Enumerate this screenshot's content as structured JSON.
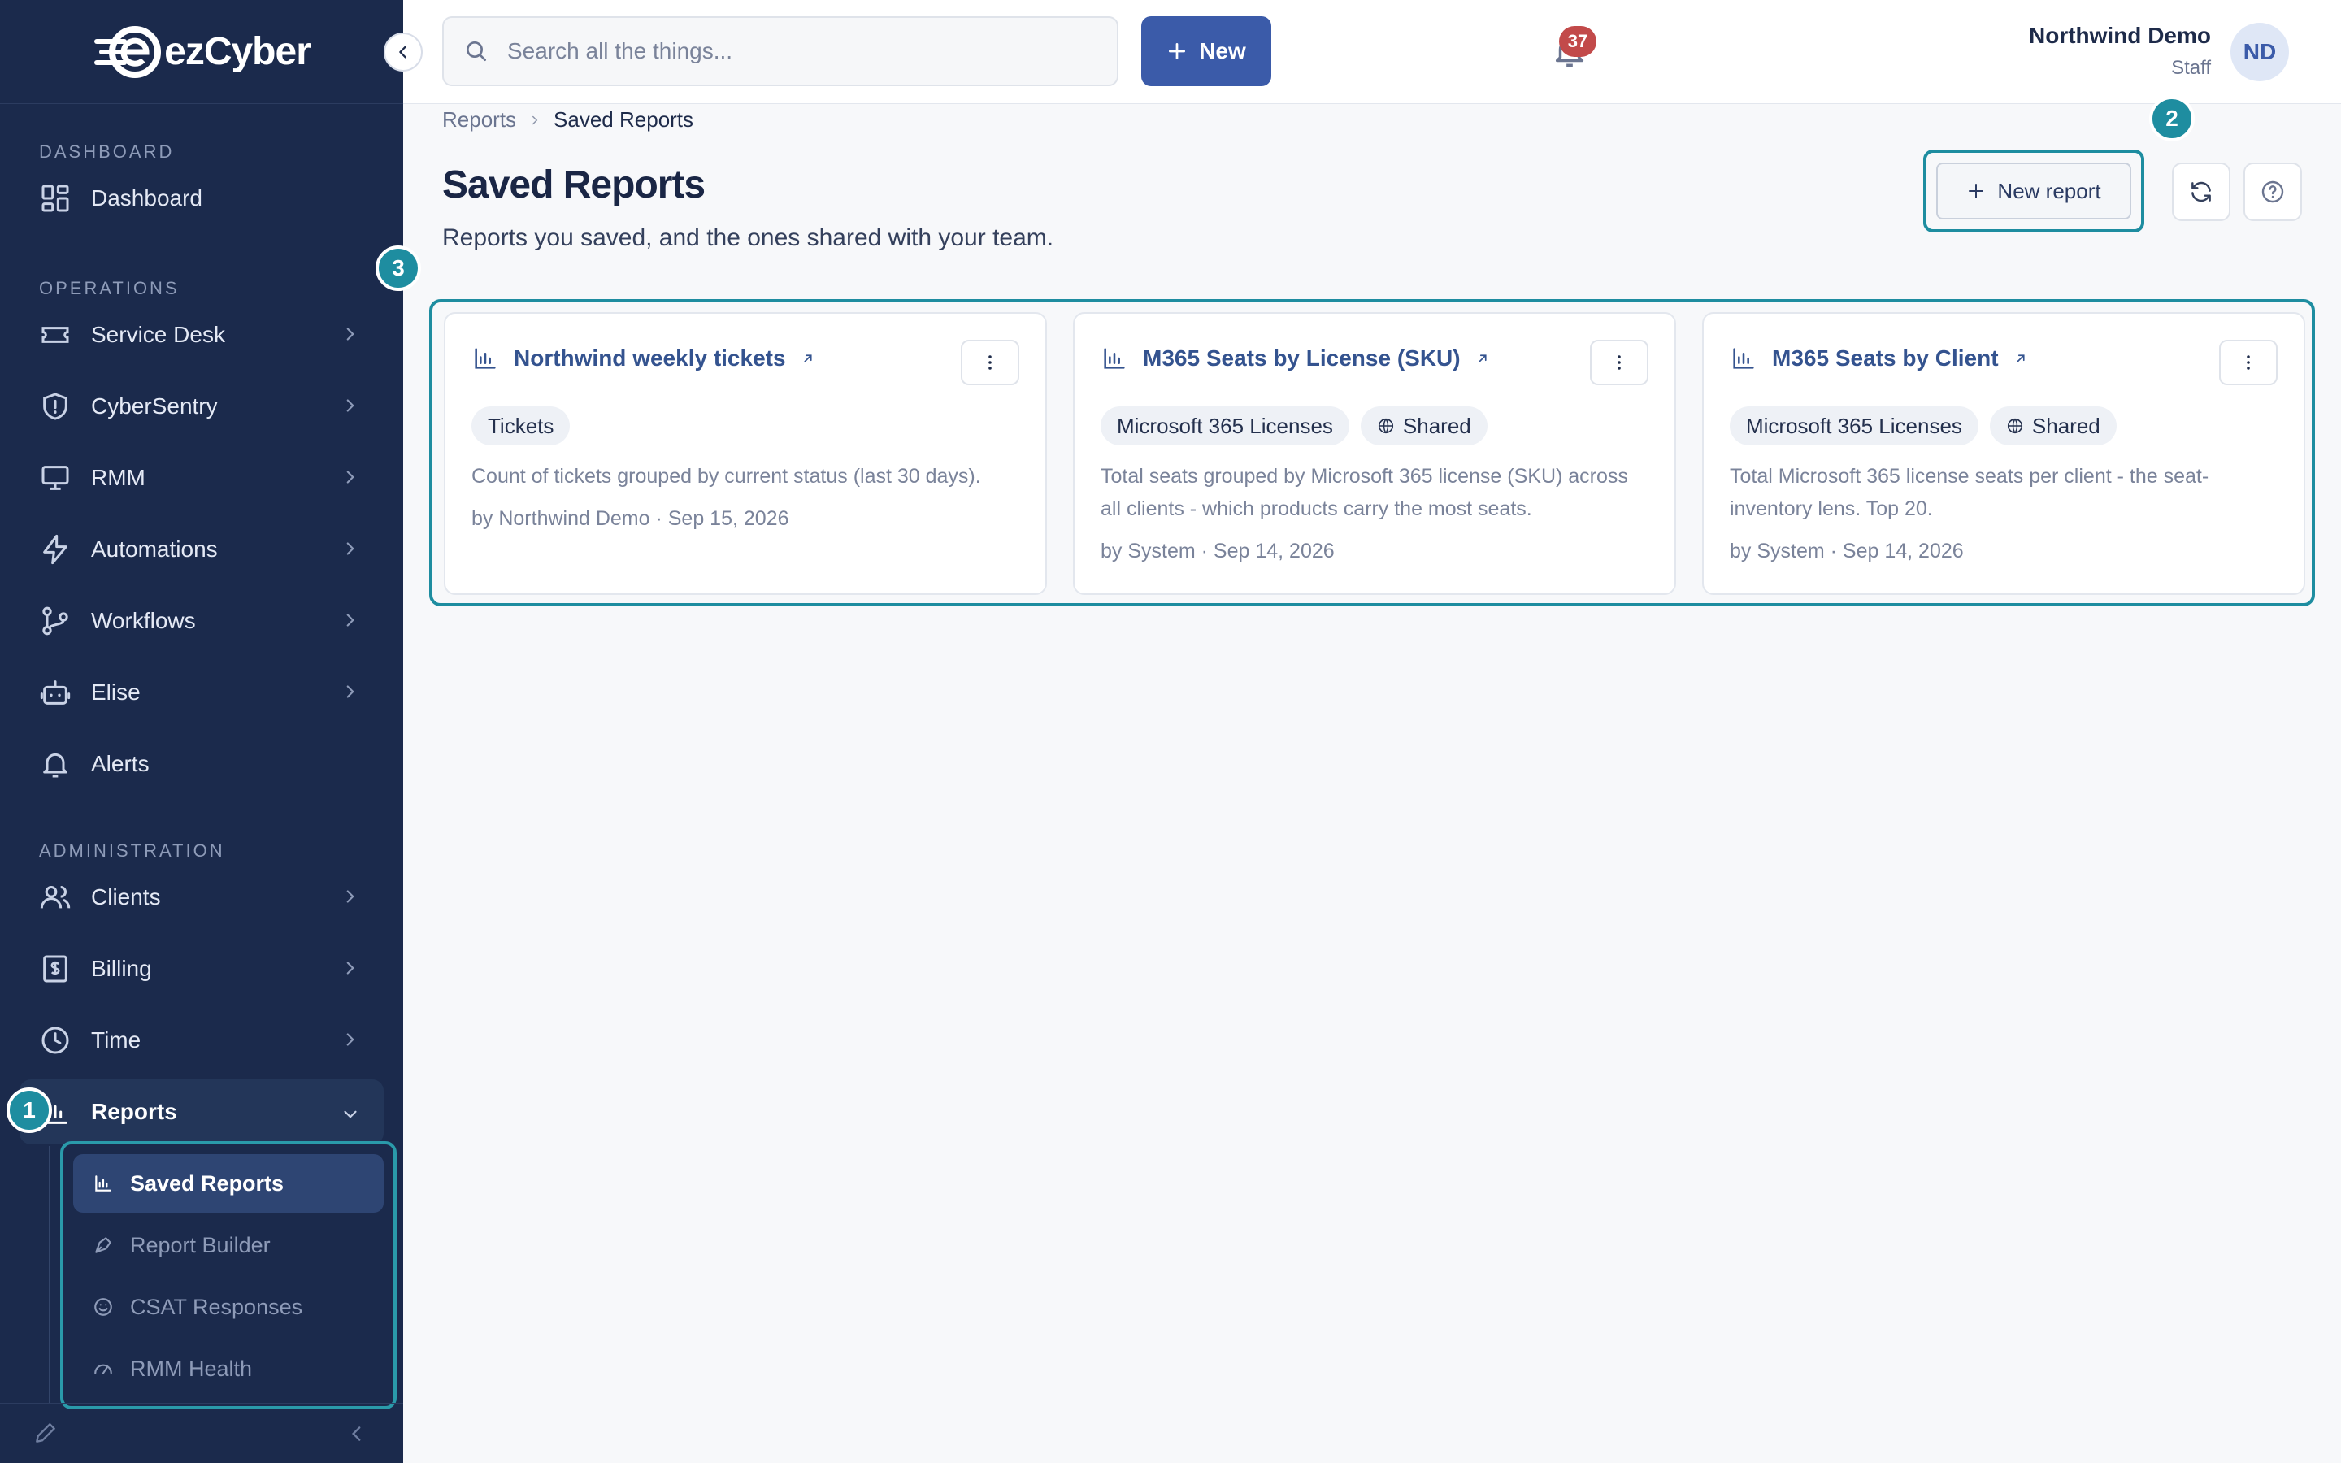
{
  "brand": {
    "name": "ezCyber",
    "accent": "#1e8da0",
    "primary": "#3b5ba9",
    "sidebar_bg": "#1b2a4c"
  },
  "topbar": {
    "search_placeholder": "Search all the things...",
    "new_label": "New",
    "notification_count": "37",
    "user_name": "Northwind Demo",
    "user_role": "Staff",
    "avatar_initials": "ND"
  },
  "sidebar": {
    "sections": [
      {
        "label": "DASHBOARD"
      },
      {
        "label": "OPERATIONS"
      },
      {
        "label": "ADMINISTRATION"
      }
    ],
    "items": [
      {
        "label": "Dashboard",
        "icon": "dashboard-icon"
      },
      {
        "label": "Service Desk",
        "icon": "ticket-icon"
      },
      {
        "label": "CyberSentry",
        "icon": "shield-icon"
      },
      {
        "label": "RMM",
        "icon": "monitor-icon"
      },
      {
        "label": "Automations",
        "icon": "bolt-icon"
      },
      {
        "label": "Workflows",
        "icon": "workflow-icon"
      },
      {
        "label": "Elise",
        "icon": "bot-icon"
      },
      {
        "label": "Alerts",
        "icon": "bell-icon"
      },
      {
        "label": "Clients",
        "icon": "users-icon"
      },
      {
        "label": "Billing",
        "icon": "billing-icon"
      },
      {
        "label": "Time",
        "icon": "clock-icon"
      },
      {
        "label": "Reports",
        "icon": "chart-icon"
      }
    ],
    "reports_submenu": [
      {
        "label": "Saved Reports",
        "icon": "chart-icon",
        "active": true
      },
      {
        "label": "Report Builder",
        "icon": "pen-tool-icon"
      },
      {
        "label": "CSAT Responses",
        "icon": "smile-icon"
      },
      {
        "label": "RMM Health",
        "icon": "gauge-icon"
      }
    ]
  },
  "main": {
    "breadcrumb": [
      "Reports",
      "Saved Reports"
    ],
    "title": "Saved Reports",
    "subtitle": "Reports you saved, and the ones shared with your team.",
    "new_report_label": "New report",
    "cards": [
      {
        "title": "Northwind weekly tickets",
        "tags": [
          "Tickets"
        ],
        "shared": false,
        "description": "Count of tickets grouped by current status (last 30 days).",
        "meta": "by Northwind Demo · Sep 15, 2026"
      },
      {
        "title": "M365 Seats by License (SKU)",
        "tags": [
          "Microsoft 365 Licenses"
        ],
        "shared": true,
        "shared_label": "Shared",
        "description": "Total seats grouped by Microsoft 365 license (SKU) across all clients - which products carry the most seats.",
        "meta": "by System · Sep 14, 2026"
      },
      {
        "title": "M365 Seats by Client",
        "tags": [
          "Microsoft 365 Licenses"
        ],
        "shared": true,
        "shared_label": "Shared",
        "description": "Total Microsoft 365 license seats per client - the seat-inventory lens. Top 20.",
        "meta": "by System · Sep 14, 2026"
      }
    ]
  },
  "annotations": [
    "1",
    "2",
    "3"
  ]
}
